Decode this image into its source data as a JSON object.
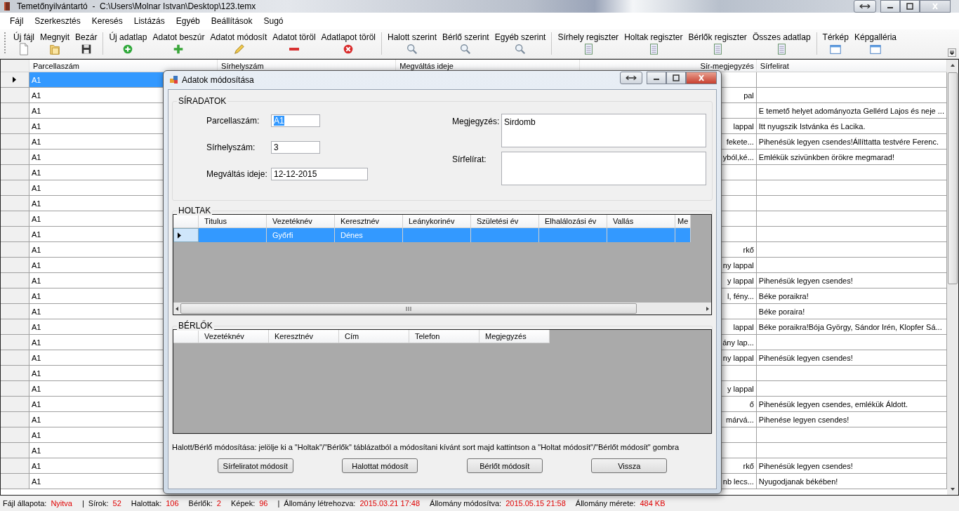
{
  "window": {
    "title": "Temetőnyilvántartó  -  C:\\Users\\Molnar Istvan\\Desktop\\123.temx"
  },
  "menu": [
    "Fájl",
    "Szerkesztés",
    "Keresés",
    "Listázás",
    "Egyéb",
    "Beállítások",
    "Sugó"
  ],
  "toolbar": [
    [
      {
        "label": "Új fájl",
        "kind": "new"
      },
      {
        "label": "Megnyit",
        "kind": "open"
      },
      {
        "label": "Bezár",
        "kind": "close"
      }
    ],
    [
      {
        "label": "Új adatlap",
        "kind": "create"
      },
      {
        "label": "Adatot beszúr",
        "kind": "insert"
      },
      {
        "label": "Adatot módosít",
        "kind": "edit"
      },
      {
        "label": "Adatot töröl",
        "kind": "remove"
      },
      {
        "label": "Adatlapot töröl",
        "kind": "delete"
      }
    ],
    [
      {
        "label": "Halott szerint",
        "kind": "search"
      },
      {
        "label": "Bérlő szerint",
        "kind": "search"
      },
      {
        "label": "Egyéb szerint",
        "kind": "search"
      }
    ],
    [
      {
        "label": "Sírhely regiszter",
        "kind": "register"
      },
      {
        "label": "Holtak regiszter",
        "kind": "register"
      },
      {
        "label": "Bérlők regiszter",
        "kind": "register"
      },
      {
        "label": "Összes adatlap",
        "kind": "register"
      }
    ],
    [
      {
        "label": "Térkép",
        "kind": "view"
      },
      {
        "label": "Képgalléria",
        "kind": "view"
      }
    ]
  ],
  "grid": {
    "columns": [
      "Parcellaszám",
      "Sírhelyszám",
      "Megváltás ideje",
      "Sír-megjegyzés",
      "Sírfelirat"
    ],
    "rows": [
      {
        "parcel": "A1",
        "note": "",
        "inscription": "",
        "selected": true
      },
      {
        "parcel": "A1",
        "note": "pal",
        "inscription": "",
        "selected": false
      },
      {
        "parcel": "A1",
        "note": "",
        "inscription": "E temető helyet adományozta Gellérd Lajos és neje ...",
        "selected": false
      },
      {
        "parcel": "A1",
        "note": "lappal",
        "inscription": "Itt nyugszik Istvánka és Lacika.",
        "selected": false
      },
      {
        "parcel": "A1",
        "note": "fekete...",
        "inscription": "Pihenésük legyen csendes!Állíttatta testvére Ferenc.",
        "selected": false
      },
      {
        "parcel": "A1",
        "note": "yból,ké...",
        "inscription": "Emlékük szivünkben örökre megmarad!",
        "selected": false
      },
      {
        "parcel": "A1",
        "note": "",
        "inscription": "",
        "selected": false
      },
      {
        "parcel": "A1",
        "note": "",
        "inscription": "",
        "selected": false
      },
      {
        "parcel": "A1",
        "note": "",
        "inscription": "",
        "selected": false
      },
      {
        "parcel": "A1",
        "note": "",
        "inscription": "",
        "selected": false
      },
      {
        "parcel": "A1",
        "note": "",
        "inscription": "",
        "selected": false
      },
      {
        "parcel": "A1",
        "note": "rkő",
        "inscription": "",
        "selected": false
      },
      {
        "parcel": "A1",
        "note": "ny lappal",
        "inscription": "",
        "selected": false
      },
      {
        "parcel": "A1",
        "note": "y lappal",
        "inscription": "Pihenésük legyen csendes!",
        "selected": false
      },
      {
        "parcel": "A1",
        "note": "l, fény...",
        "inscription": "Béke poraikra!",
        "selected": false
      },
      {
        "parcel": "A1",
        "note": "",
        "inscription": "Béke poraira!",
        "selected": false
      },
      {
        "parcel": "A1",
        "note": "lappal",
        "inscription": "Béke poraikra!Bója György, Sándor Irén, Klopfer Sá...",
        "selected": false
      },
      {
        "parcel": "A1",
        "note": "ány lap...",
        "inscription": "",
        "selected": false
      },
      {
        "parcel": "A1",
        "note": "ny lappal",
        "inscription": "Pihenésük legyen csendes!",
        "selected": false
      },
      {
        "parcel": "A1",
        "note": "",
        "inscription": "",
        "selected": false
      },
      {
        "parcel": "A1",
        "note": "y lappal",
        "inscription": "",
        "selected": false
      },
      {
        "parcel": "A1",
        "note": "ő",
        "inscription": "Pihenésük legyen csendes, emlékük Áldott.",
        "selected": false
      },
      {
        "parcel": "A1",
        "note": "márvá...",
        "inscription": "Pihenése legyen csendes!",
        "selected": false
      },
      {
        "parcel": "A1",
        "note": "",
        "inscription": "",
        "selected": false
      },
      {
        "parcel": "A1",
        "note": "",
        "inscription": "",
        "selected": false
      },
      {
        "parcel": "A1",
        "note": "rkő",
        "inscription": "Pihenésük legyen csendes!",
        "selected": false
      },
      {
        "parcel": "A1",
        "note": "nb lecs...",
        "inscription": "Nyugodjanak békében!",
        "selected": false
      }
    ]
  },
  "dialog": {
    "title": "Adatok módosítása",
    "grave_group": {
      "title": "SÍRADATOK",
      "left_fields": [
        {
          "label": "Parcellaszám:",
          "value": "A1",
          "text_selected": true
        },
        {
          "label": "Sírhelyszám:",
          "value": "3",
          "text_selected": false
        },
        {
          "label": "Megváltás ideje:",
          "value": "12-12-2015",
          "text_selected": false
        }
      ],
      "right_fields": [
        {
          "label": "Megjegyzés:",
          "value": "Sirdomb"
        },
        {
          "label": "Sírfelírat:"
        }
      ]
    },
    "dead_group": {
      "title": "HOLTAK",
      "columns": [
        "Titulus",
        "Vezetéknév",
        "Keresztnév",
        "Leánykorinév",
        "Születési év",
        "Elhalálozási év",
        "Vallás",
        "Me"
      ],
      "rows": [
        {
          "cells": [
            "",
            "Győrfi",
            "Dénes",
            "",
            "",
            "",
            "",
            ""
          ],
          "selected": true
        }
      ]
    },
    "tenant_group": {
      "title": "BÉRLŐK",
      "columns": [
        "Vezetéknév",
        "Keresztnév",
        "Cím",
        "Telefon",
        "Megjegyzés"
      ]
    },
    "hint": "Halott/Bérlő módosítása: jelölje ki a \"Holtak\"/\"Bérlők\" táblázatból a módosítani kívánt sort majd kattintson a \"Holtat módosít\"/\"Bérlőt módosít\" gombra",
    "buttons": [
      "Sírfeliratot módosít",
      "Halottat módosít",
      "Bérlőt módosít",
      "Vissza"
    ]
  },
  "status_bar": [
    {
      "kind": "pair",
      "label": "Fájl állapota:",
      "value": "Nyitva"
    },
    {
      "kind": "sep",
      "text": "|"
    },
    {
      "kind": "pair",
      "label": "Sírok:",
      "value": "52"
    },
    {
      "kind": "pair",
      "label": "Halottak:",
      "value": "106"
    },
    {
      "kind": "pair",
      "label": "Bérlők:",
      "value": "2"
    },
    {
      "kind": "pair",
      "label": "Képek:",
      "value": "96"
    },
    {
      "kind": "sep",
      "text": "|"
    },
    {
      "kind": "pair",
      "label": "Állomány létrehozva:",
      "value": "2015.03.21 17:48"
    },
    {
      "kind": "pair",
      "label": "Állomány módosítva:",
      "value": "2015.05.15 21:58"
    },
    {
      "kind": "pair",
      "label": "Állomány mérete:",
      "value": "484 KB"
    }
  ]
}
